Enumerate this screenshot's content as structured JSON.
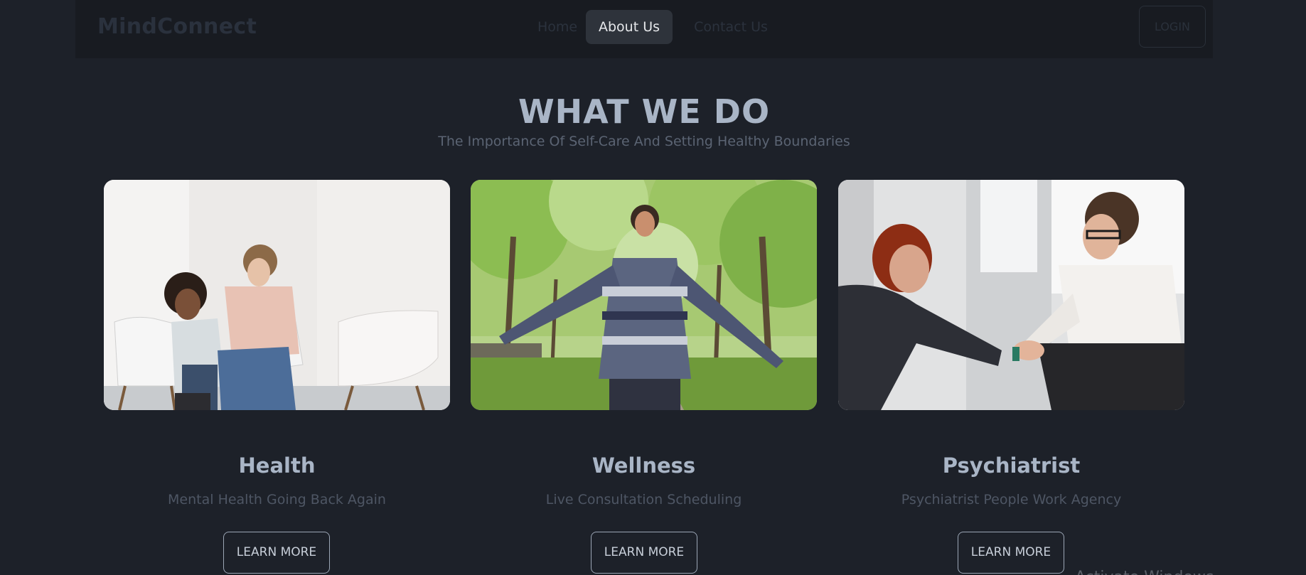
{
  "navbar": {
    "brand": "MindConnect",
    "links": [
      {
        "label": "Home"
      },
      {
        "label": "About Us",
        "active": true
      },
      {
        "label": "Contact Us"
      }
    ],
    "login_label": "LOGIN"
  },
  "hero": {
    "title": "WHAT WE DO",
    "subtitle": "The Importance Of Self-Care And Setting Healthy Boundaries"
  },
  "cards": [
    {
      "title": "Health",
      "subtitle": "Mental Health Going Back Again",
      "button": "LEARN MORE",
      "image": "two women comforting on white chairs"
    },
    {
      "title": "Wellness",
      "subtitle": "Live Consultation Scheduling",
      "button": "LEARN MORE",
      "image": "woman with open arms in green park"
    },
    {
      "title": "Psychiatrist",
      "subtitle": "Psychiatrist People Work Agency",
      "button": "LEARN MORE",
      "image": "man holding woman's hands"
    }
  ],
  "watermark": "Activate Windows",
  "colors": {
    "background": "#1d2129",
    "navbar": "#181b21",
    "active_tab": "#2e333b",
    "heading": "#a9b5c6"
  }
}
